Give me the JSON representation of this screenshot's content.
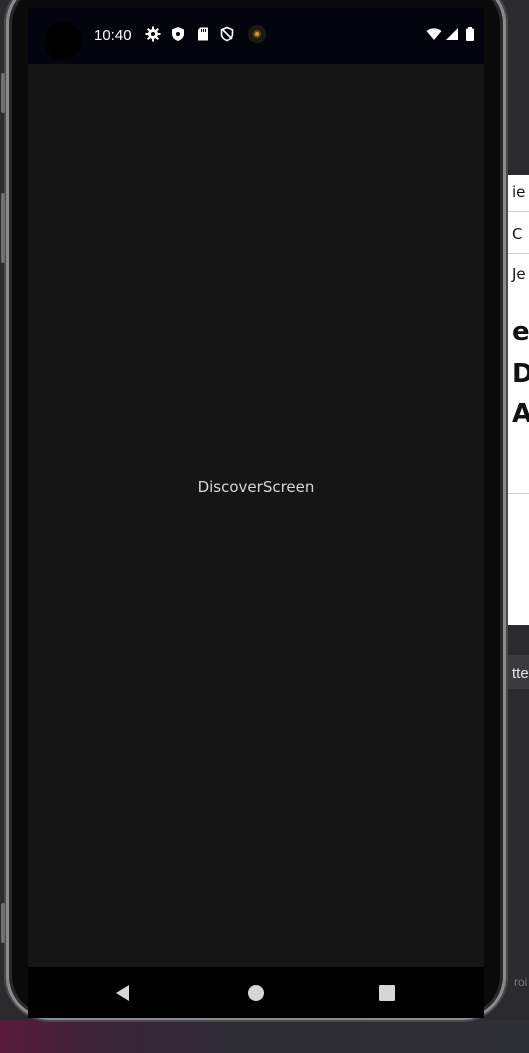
{
  "status_bar": {
    "time": "10:40",
    "left_icons": [
      "gear-icon",
      "shield-icon",
      "sd-card-icon",
      "vpn-shield-icon",
      "camera-dot-icon"
    ],
    "right_icons": [
      "wifi-icon",
      "signal-icon",
      "battery-icon"
    ]
  },
  "screen": {
    "label": "DiscoverScreen"
  },
  "nav_bar": {
    "buttons": [
      "back-icon",
      "home-icon",
      "recents-icon"
    ]
  },
  "side_window": {
    "fragments": [
      "ie",
      "C",
      "Je",
      "e",
      "D",
      "A"
    ],
    "tab_fragment": "tte",
    "hint_fragment": "roi"
  },
  "colors": {
    "screen_background": "#151515",
    "status_bar_background": "#04040f",
    "label_text": "#d6d6d6"
  }
}
